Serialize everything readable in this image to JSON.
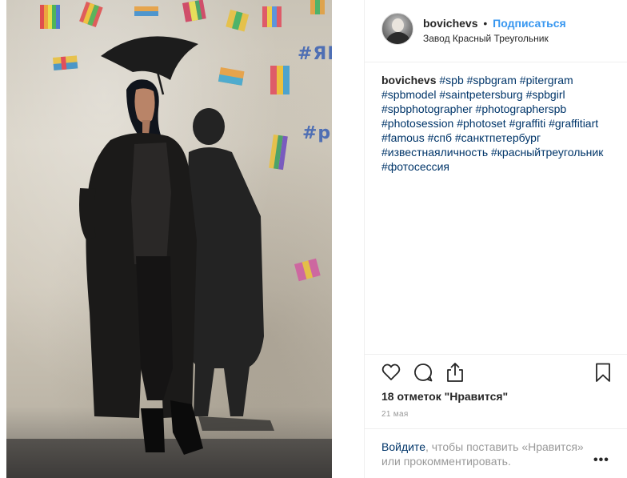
{
  "post": {
    "username": "bovichevs",
    "separator": "•",
    "follow_label": "Подписаться",
    "location": "Завод Красный Треугольник"
  },
  "caption": {
    "username": "bovichevs",
    "hashtags": [
      "#spb",
      "#spbgram",
      "#pitergram",
      "#spbmodel",
      "#saintpetersburg",
      "#spbgirl",
      "#spbphotographer",
      "#photographerspb",
      "#photosession",
      "#photoset",
      "#graffiti",
      "#graffitiart",
      "#famous",
      "#спб",
      "#санктпетербург",
      "#известнаяличность",
      "#красныйтреугольник",
      "#фотосессия"
    ]
  },
  "photo": {
    "graffiti_text_1": "#ЯВ",
    "graffiti_text_2": "#ро"
  },
  "actions": {
    "like_icon": "heart-outline-icon",
    "comment_icon": "speech-bubble-icon",
    "share_icon": "share-upload-icon",
    "save_icon": "bookmark-icon"
  },
  "likes_text": "18 отметок \"Нравится\"",
  "date_text": "21 мая",
  "login_prompt": {
    "link_label": "Войдите",
    "rest_text": ", чтобы поставить «Нравится» или прокомментировать."
  },
  "more_label": "•••",
  "colors": {
    "accent": "#3897f0",
    "hashtag": "#003569",
    "muted": "#999999",
    "text": "#262626"
  }
}
